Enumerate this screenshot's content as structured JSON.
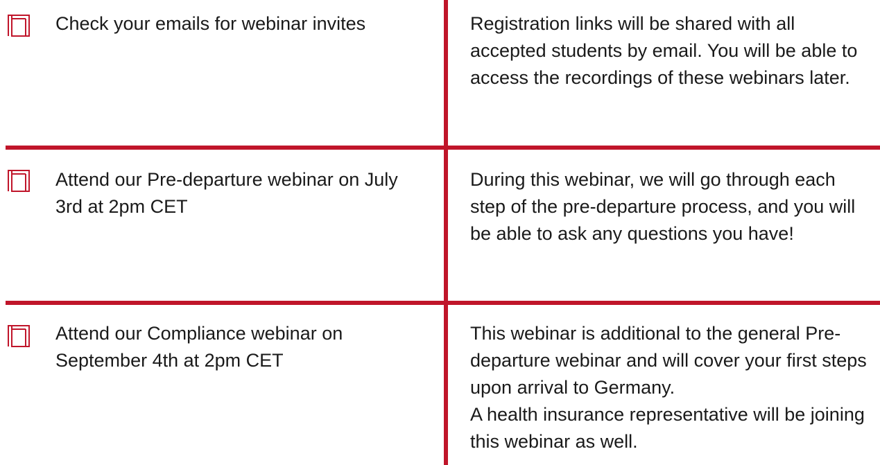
{
  "colors": {
    "accent": "#c0152a",
    "text": "#1a1a1a",
    "background": "#ffffff"
  },
  "rows": [
    {
      "icon": "frame-corner-icon",
      "step": "Check your emails for webinar invites",
      "description": "Registration links will be shared with all accepted students by email. You will be able to access the recordings of these webinars later."
    },
    {
      "icon": "frame-corner-icon",
      "step": "Attend our Pre-departure webinar on July 3rd at 2pm CET",
      "description": "During this webinar, we will go through each step of the pre-departure process, and you will be able to ask any questions you have!"
    },
    {
      "icon": "frame-corner-icon",
      "step": "Attend our Compliance webinar on September 4th at 2pm CET",
      "description": "This webinar is additional to the general Pre-departure webinar and will cover your first steps upon arrival to Germany.\nA health insurance representative will be joining this webinar as well."
    }
  ]
}
